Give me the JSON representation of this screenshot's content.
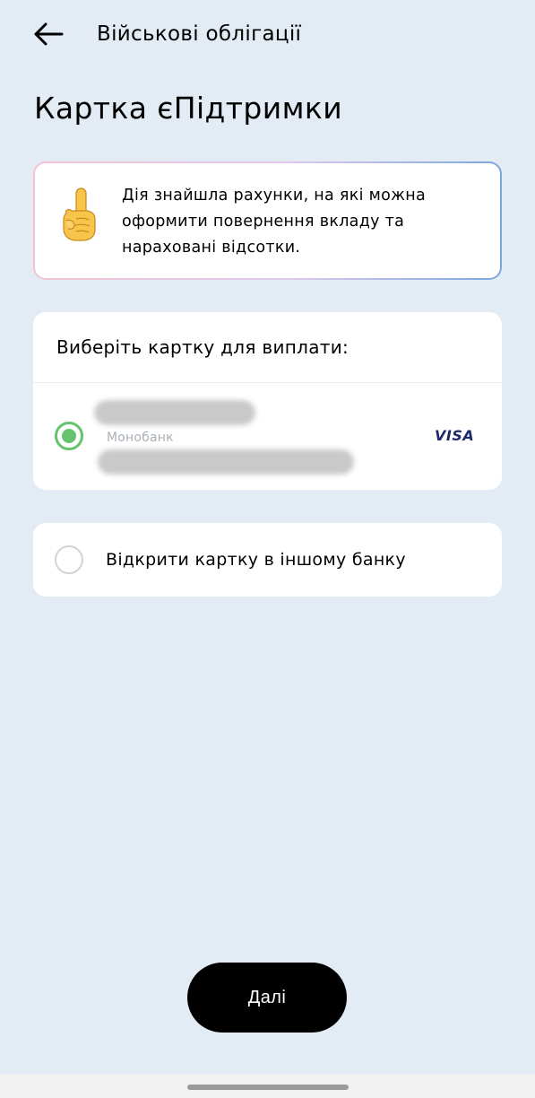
{
  "header": {
    "title": "Військові облігації",
    "back_icon": "arrow-left-icon"
  },
  "page": {
    "title": "Картка єПідтримки"
  },
  "notice": {
    "icon": "pointing-up-hand-icon",
    "text": "Дія знайшла рахунки, на які можна оформити повернення вкладу та нараховані відсотки."
  },
  "card_select": {
    "heading": "Виберіть картку для виплати:",
    "cards": [
      {
        "bank": "Монобанк",
        "network": "VISA",
        "selected": true
      }
    ],
    "other_option": {
      "label": "Відкрити картку в іншому банку",
      "selected": false
    }
  },
  "footer": {
    "next_label": "Далі"
  },
  "colors": {
    "background": "#e3ecf4",
    "card": "#ffffff",
    "radio_active": "#66c36d",
    "button": "#000000",
    "visa": "#1b2a6b"
  }
}
